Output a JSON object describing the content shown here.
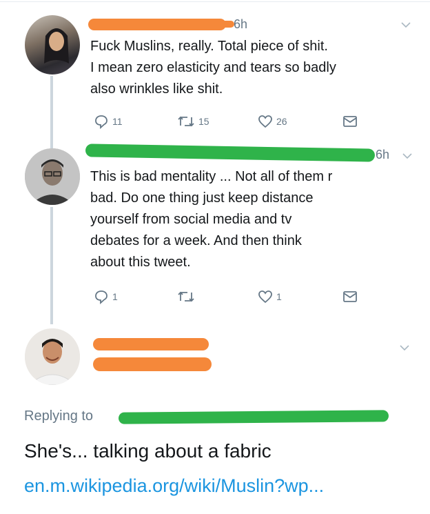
{
  "tweets": [
    {
      "time": "6h",
      "text_lines": [
        "Fuck Muslins, really. Total piece of shit.",
        "I mean zero elasticity and tears so badly",
        "also wrinkles like shit."
      ],
      "replies": "11",
      "retweets": "15",
      "likes": "26"
    },
    {
      "time": "6h",
      "text_lines": [
        "This is bad mentality ... Not all of them r",
        "bad. Do one thing just keep distance",
        "yourself from social media and tv",
        "debates for a week. And then think",
        "about this tweet."
      ],
      "replies": "1",
      "retweets": "",
      "likes": "1"
    }
  ],
  "reply": {
    "replying_to_label": "Replying to",
    "text": "She's... talking about a fabric",
    "link": "en.m.wikipedia.org/wiki/Muslin?wp..."
  },
  "icons": [
    "reply-icon",
    "retweet-icon",
    "like-icon",
    "message-icon",
    "chevron-down-icon"
  ],
  "colors": {
    "redaction_orange": "#f5883a",
    "redaction_green": "#2fb34a",
    "link_blue": "#1b95e0",
    "secondary_gray": "#657786"
  }
}
